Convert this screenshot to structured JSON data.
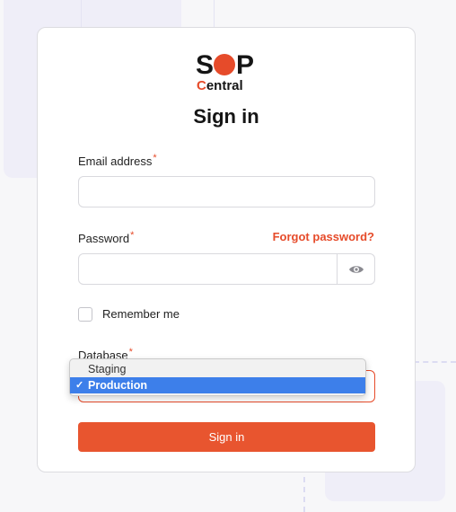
{
  "logo": {
    "line1_s": "S",
    "line1_c": "C",
    "line1_p": "P",
    "line2_c": "C",
    "line2_rest": "entral"
  },
  "title": "Sign in",
  "email": {
    "label": "Email address",
    "required": "*",
    "value": ""
  },
  "password": {
    "label": "Password",
    "required": "*",
    "value": "",
    "forgot": "Forgot password?"
  },
  "remember": {
    "label": "Remember me",
    "checked": false
  },
  "database": {
    "label": "Database",
    "required": "*",
    "options": [
      "Staging",
      "Production"
    ],
    "selected": "Production",
    "check": "✓"
  },
  "submit": "Sign in",
  "colors": {
    "accent": "#e8552f",
    "select_highlight": "#3d7fea"
  },
  "icons": {
    "password_toggle": "eye-icon",
    "selected_option": "checkmark-icon"
  }
}
